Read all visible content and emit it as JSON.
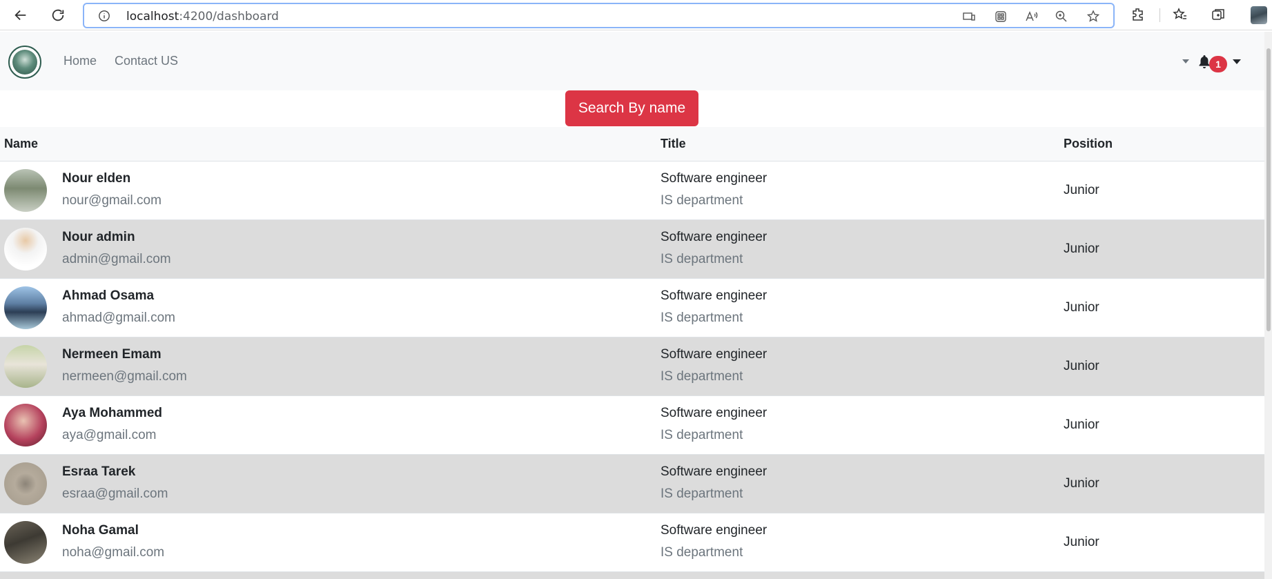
{
  "browser": {
    "url_host": "localhost",
    "url_path": ":4200/dashboard"
  },
  "navbar": {
    "links": [
      "Home",
      "Contact US"
    ],
    "notification_count": "1"
  },
  "search_button_label": "Search By name",
  "table": {
    "headers": {
      "name": "Name",
      "title": "Title",
      "position": "Position"
    },
    "rows": [
      {
        "name": "Nour elden",
        "email": "nour@gmail.com",
        "title": "Software engineer",
        "department": "IS department",
        "position": "Junior"
      },
      {
        "name": "Nour admin",
        "email": "admin@gmail.com",
        "title": "Software engineer",
        "department": "IS department",
        "position": "Junior"
      },
      {
        "name": "Ahmad Osama",
        "email": "ahmad@gmail.com",
        "title": "Software engineer",
        "department": "IS department",
        "position": "Junior"
      },
      {
        "name": "Nermeen Emam",
        "email": "nermeen@gmail.com",
        "title": "Software engineer",
        "department": "IS department",
        "position": "Junior"
      },
      {
        "name": "Aya Mohammed",
        "email": "aya@gmail.com",
        "title": "Software engineer",
        "department": "IS department",
        "position": "Junior"
      },
      {
        "name": "Esraa Tarek",
        "email": "esraa@gmail.com",
        "title": "Software engineer",
        "department": "IS department",
        "position": "Junior"
      },
      {
        "name": "Noha Gamal",
        "email": "noha@gmail.com",
        "title": "Software engineer",
        "department": "IS department",
        "position": "Junior"
      }
    ]
  },
  "colors": {
    "accent_red": "#dc3545",
    "row_alt": "#dcdcdc",
    "navbar_bg": "#f8f9fa"
  }
}
